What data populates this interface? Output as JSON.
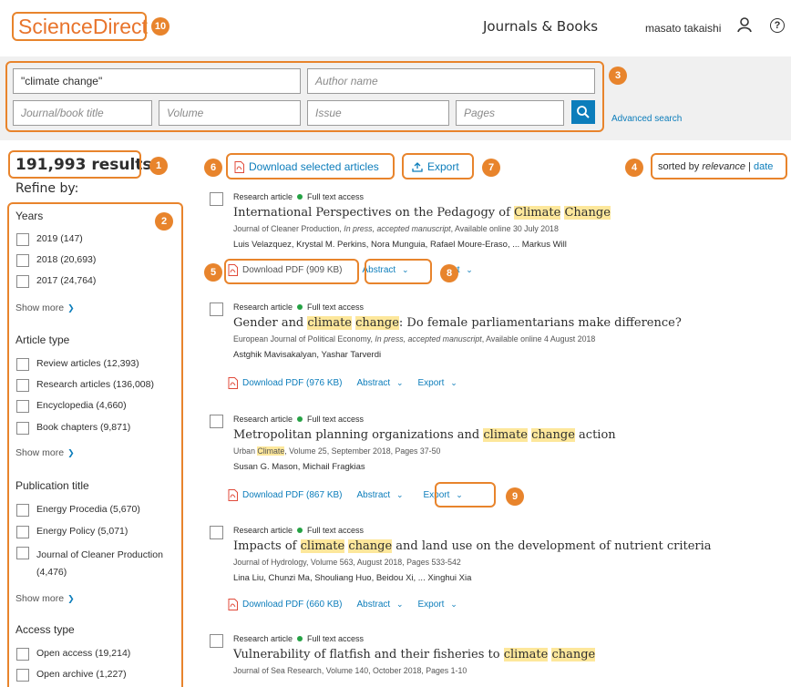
{
  "header": {
    "logo": "ScienceDirect",
    "journals_books": "Journals & Books",
    "user_name": "masato takaishi",
    "help_glyph": "?"
  },
  "search": {
    "keywords_value": "\"climate change\"",
    "author_placeholder": "Author name",
    "journal_placeholder": "Journal/book title",
    "volume_placeholder": "Volume",
    "issue_placeholder": "Issue",
    "pages_placeholder": "Pages",
    "advanced_link": "Advanced search"
  },
  "results_count": "191,993 results",
  "refine_by": "Refine by:",
  "filters": {
    "years": {
      "heading": "Years",
      "items": [
        "2019 (147)",
        "2018 (20,693)",
        "2017 (24,764)"
      ],
      "show_more": "Show more"
    },
    "article_type": {
      "heading": "Article type",
      "items": [
        "Review articles (12,393)",
        "Research articles (136,008)",
        "Encyclopedia (4,660)",
        "Book chapters (9,871)"
      ],
      "show_more": "Show more"
    },
    "publication_title": {
      "heading": "Publication title",
      "items": [
        "Energy Procedia (5,670)",
        "Energy Policy (5,071)",
        "Journal of Cleaner Production (4,476)"
      ],
      "show_more": "Show more"
    },
    "access_type": {
      "heading": "Access type",
      "items": [
        "Open access (19,214)",
        "Open archive (1,227)"
      ]
    }
  },
  "toolbar": {
    "download_selected": "Download selected articles",
    "export": "Export",
    "sorted_by_prefix": "sorted by",
    "sort_relevance": "relevance",
    "sort_separator": "|",
    "sort_date": "date"
  },
  "results": [
    {
      "type": "Research article",
      "access": "Full text access",
      "title_parts": [
        "International Perspectives on the Pedagogy of ",
        "Climate",
        " ",
        "Change",
        ""
      ],
      "journal": "Journal of Cleaner Production, ",
      "status": "In press, accepted manuscript",
      "date": ", Available online 30 July 2018",
      "authors": "Luis Velazquez, Krystal M. Perkins, Nora Munguia, Rafael Moure-Eraso, ... Markus Will",
      "download": "Download PDF (909 KB)",
      "abstract": "Abstract",
      "export": "Export"
    },
    {
      "type": "Research article",
      "access": "Full text access",
      "title_parts": [
        "Gender and ",
        "climate",
        " ",
        "change",
        ": Do female parliamentarians make difference?"
      ],
      "journal": "European Journal of Political Economy, ",
      "status": "In press, accepted manuscript",
      "date": ", Available online 4 August 2018",
      "authors": "Astghik Mavisakalyan, Yashar Tarverdi",
      "download": "Download PDF (976 KB)",
      "abstract": "Abstract",
      "export": "Export"
    },
    {
      "type": "Research article",
      "access": "Full text access",
      "title_parts": [
        "Metropolitan planning organizations and ",
        "climate",
        " ",
        "change",
        " action"
      ],
      "journal_pre": "Urban ",
      "journal_hl": "Climate",
      "journal_post": ", Volume 25, September 2018, Pages 37-50",
      "authors": "Susan G. Mason, Michail Fragkias",
      "download": "Download PDF (867 KB)",
      "abstract": "Abstract",
      "export": "Export"
    },
    {
      "type": "Research article",
      "access": "Full text access",
      "title_parts": [
        "Impacts of ",
        "climate",
        " ",
        "change",
        " and land use on the development of nutrient criteria"
      ],
      "journal": "Journal of Hydrology, Volume 563, August 2018, Pages 533-542",
      "authors": "Lina Liu, Chunzi Ma, Shouliang Huo, Beidou Xi, ... Xinghui Xia",
      "download": "Download PDF (660 KB)",
      "abstract": "Abstract",
      "export": "Export"
    },
    {
      "type": "Research article",
      "access": "Full text access",
      "title_parts": [
        "Vulnerability of flatfish and their fisheries to ",
        "climate",
        " ",
        "change",
        ""
      ],
      "journal": "Journal of Sea Research, Volume 140, October 2018, Pages 1-10"
    }
  ],
  "callouts": {
    "c1": "1",
    "c2": "2",
    "c3": "3",
    "c4": "4",
    "c5": "5",
    "c6": "6",
    "c7": "7",
    "c8": "8",
    "c9": "9",
    "c10": "10"
  },
  "colors": {
    "accent_orange": "#e8842c",
    "logo_orange": "#e8742c",
    "link_blue": "#0c7dbb",
    "highlight": "#fde79b",
    "access_green": "#25a244"
  }
}
